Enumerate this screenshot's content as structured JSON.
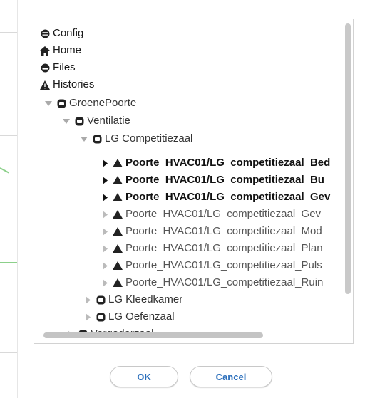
{
  "tree": {
    "roots": [
      {
        "label": "Config",
        "icon": "gear-icon"
      },
      {
        "label": "Home",
        "icon": "home-icon"
      },
      {
        "label": "Files",
        "icon": "drive-icon"
      },
      {
        "label": "Histories",
        "icon": "warning-icon"
      }
    ],
    "groenepoorte": {
      "label": "GroenePoorte",
      "icon": "component-icon",
      "expanded": true
    },
    "ventilatie": {
      "label": "Ventilatie",
      "icon": "component-icon",
      "expanded": true
    },
    "competitiezaal": {
      "label": "LG Competitiezaal",
      "icon": "component-icon",
      "expanded": true
    },
    "points": [
      {
        "label": "Poorte_HVAC01/LG_competitiezaal_Bed",
        "bold": true
      },
      {
        "label": "Poorte_HVAC01/LG_competitiezaal_Bu",
        "bold": true
      },
      {
        "label": "Poorte_HVAC01/LG_competitiezaal_Gev",
        "bold": true
      },
      {
        "label": "Poorte_HVAC01/LG_competitiezaal_Gev",
        "bold": false
      },
      {
        "label": "Poorte_HVAC01/LG_competitiezaal_Mod",
        "bold": false
      },
      {
        "label": "Poorte_HVAC01/LG_competitiezaal_Plan",
        "bold": false
      },
      {
        "label": "Poorte_HVAC01/LG_competitiezaal_Puls",
        "bold": false
      },
      {
        "label": "Poorte_HVAC01/LG_competitiezaal_Ruin",
        "bold": false
      }
    ],
    "siblings": [
      {
        "label": "LG Kleedkamer",
        "icon": "component-icon"
      },
      {
        "label": "LG Oefenzaal",
        "icon": "component-icon"
      }
    ],
    "partial": {
      "label": "Vergaderzaal",
      "icon": "component-icon"
    }
  },
  "buttons": {
    "ok": "OK",
    "cancel": "Cancel"
  },
  "colors": {
    "accent": "#2a6ebb",
    "border": "#d2d2d2"
  }
}
